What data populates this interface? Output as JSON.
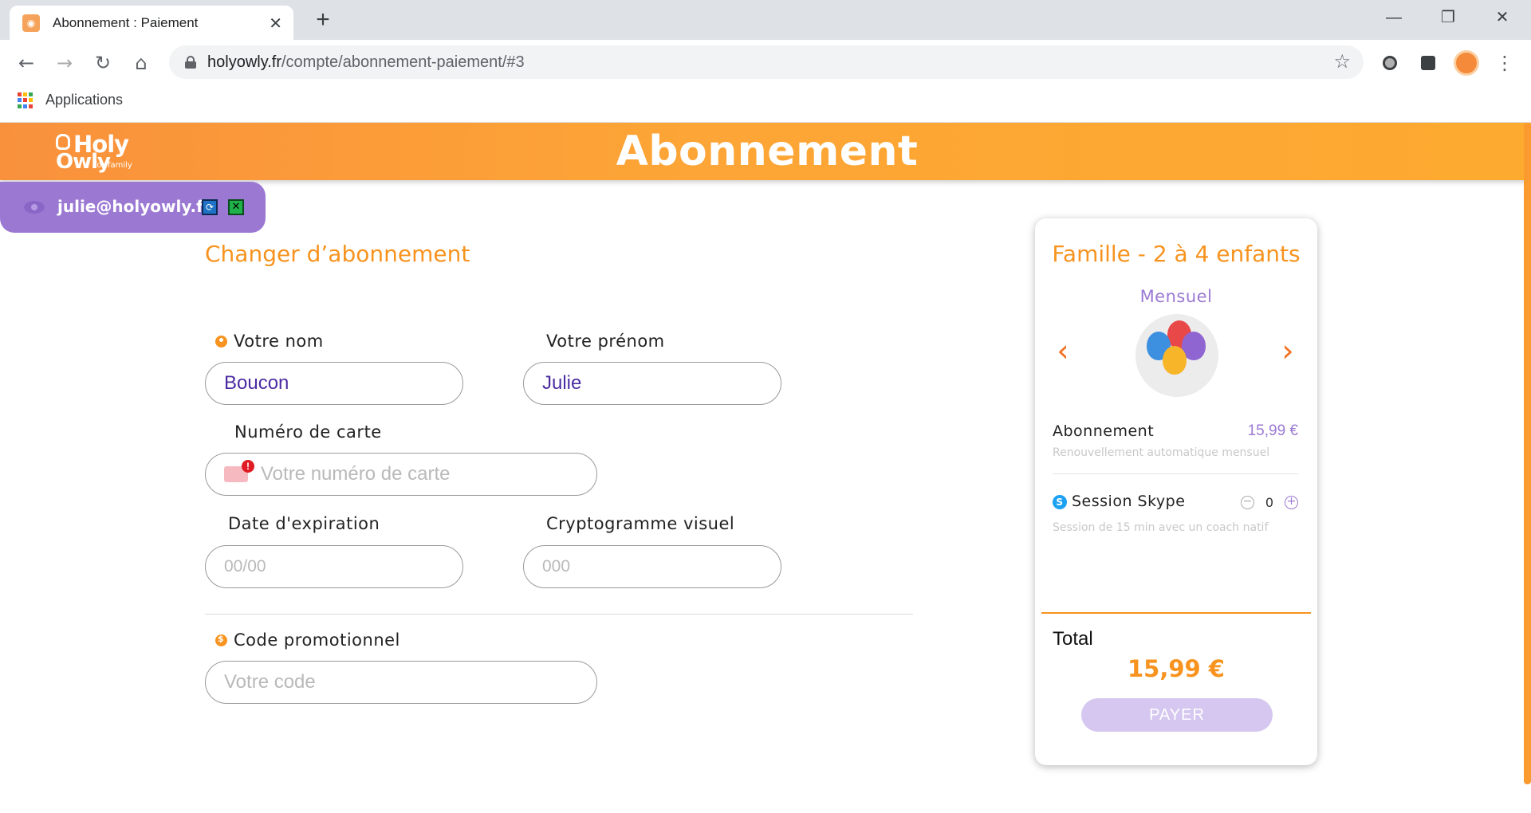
{
  "browser": {
    "tab_title": "Abonnement : Paiement",
    "tab_close": "✕",
    "new_tab": "+",
    "url_host": "holyowly.fr",
    "url_path": "/compte/abonnement-paiement/#3",
    "bookmarks_label": "Applications",
    "window_controls": {
      "minimize": "—",
      "restore": "❐",
      "close": "✕"
    }
  },
  "header": {
    "logo_line1": "Holy",
    "logo_line2": "Owly",
    "logo_tagline": "for family",
    "title": "Abonnement"
  },
  "user_badge": {
    "email": "julie@holyowly.fr"
  },
  "form": {
    "section_title": "Changer d’abonnement",
    "last_name_label": "Votre nom",
    "last_name_value": "Boucon",
    "first_name_label": "Votre prénom",
    "first_name_value": "Julie",
    "card_label": "Numéro de carte",
    "card_placeholder": "Votre numéro de carte",
    "expiry_label": "Date d'expiration",
    "expiry_placeholder": "00/00",
    "cvv_label": "Cryptogramme visuel",
    "cvv_placeholder": "000",
    "promo_label": "Code promotionnel",
    "promo_placeholder": "Votre code"
  },
  "summary": {
    "plan_name": "Famille - 2 à 4 enfants",
    "period": "Mensuel",
    "prev_arrow": "‹",
    "next_arrow": "›",
    "subscription_label": "Abonnement",
    "subscription_price": "15,99 €",
    "subscription_note": "Renouvellement automatique mensuel",
    "skype_label": "Session Skype",
    "skype_qty": "0",
    "skype_note": "Session de 15 min avec un coach natif",
    "total_label": "Total",
    "total_value": "15,99 €",
    "pay_button": "PAYER"
  },
  "colors": {
    "accent_orange": "#f7931e",
    "accent_purple": "#9b79d3",
    "pay_disabled": "#d5c7ef"
  }
}
